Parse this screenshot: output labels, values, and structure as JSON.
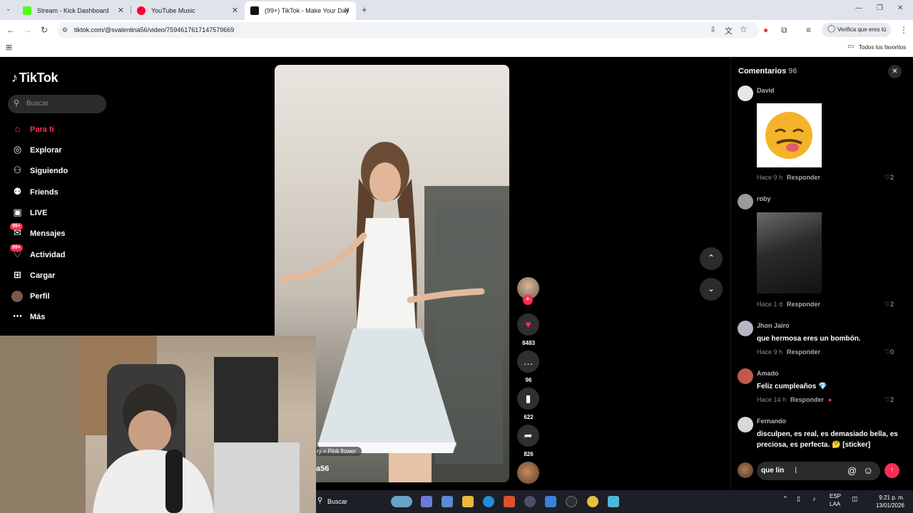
{
  "browser": {
    "tabs": [
      {
        "title": "Stream - Kick Dashboard",
        "color": "#53fc18"
      },
      {
        "title": "YouTube Music",
        "color": "#ff0033"
      },
      {
        "title": "(99+) TikTok - Make Your Day",
        "color": "#111111"
      }
    ],
    "url": "tiktok.com/@svalentina56/video/7594617617147579669",
    "verify_label": "Verifica que eres tú",
    "bookmarks_label": "Todos los favoritos"
  },
  "sidebar": {
    "logo": "TikTok",
    "search_placeholder": "Buscar",
    "items": [
      {
        "label": "Para ti",
        "icon": "home-icon"
      },
      {
        "label": "Explorar",
        "icon": "compass-icon"
      },
      {
        "label": "Siguiendo",
        "icon": "following-icon"
      },
      {
        "label": "Friends",
        "icon": "friends-icon"
      },
      {
        "label": "LIVE",
        "icon": "live-icon"
      },
      {
        "label": "Mensajes",
        "icon": "messages-icon",
        "badge": "99+"
      },
      {
        "label": "Actividad",
        "icon": "activity-icon",
        "badge": "99+"
      },
      {
        "label": "Cargar",
        "icon": "upload-icon"
      },
      {
        "label": "Perfil",
        "icon": "profile-icon"
      },
      {
        "label": "Más",
        "icon": "more-icon"
      }
    ]
  },
  "video": {
    "music_caption": "ry + Pink flower",
    "author_caption": "a56"
  },
  "actions": {
    "likes": "8483",
    "comments": "96",
    "saves": "622",
    "shares": "826"
  },
  "comments": {
    "title": "Comentarios",
    "count": "96",
    "reply_label": "Responder",
    "items": [
      {
        "name": "David",
        "text": "",
        "time": "Hace 9 h",
        "likes": "2"
      },
      {
        "name": "roby",
        "text": "",
        "time": "Hace 1 d",
        "likes": "2"
      },
      {
        "name": "Jhon Jairo",
        "text": "que hermosa eres un bombón.",
        "time": "Hace 9 h",
        "likes": "0"
      },
      {
        "name": "Amado",
        "text": "Feliz cumpleaños 💎",
        "time": "Hace 14 h",
        "likes": "2"
      },
      {
        "name": "Fernando",
        "text": "disculpen, es real, es demasiado bella, es preciosa, es perfecta. 🤔 [sticker]"
      }
    ],
    "input_value": "que lin"
  },
  "taskbar": {
    "search_label": "Buscar",
    "lang": "ESP",
    "lang2": "LAA",
    "time": "9:21 p. m.",
    "date": "13/01/2026"
  }
}
